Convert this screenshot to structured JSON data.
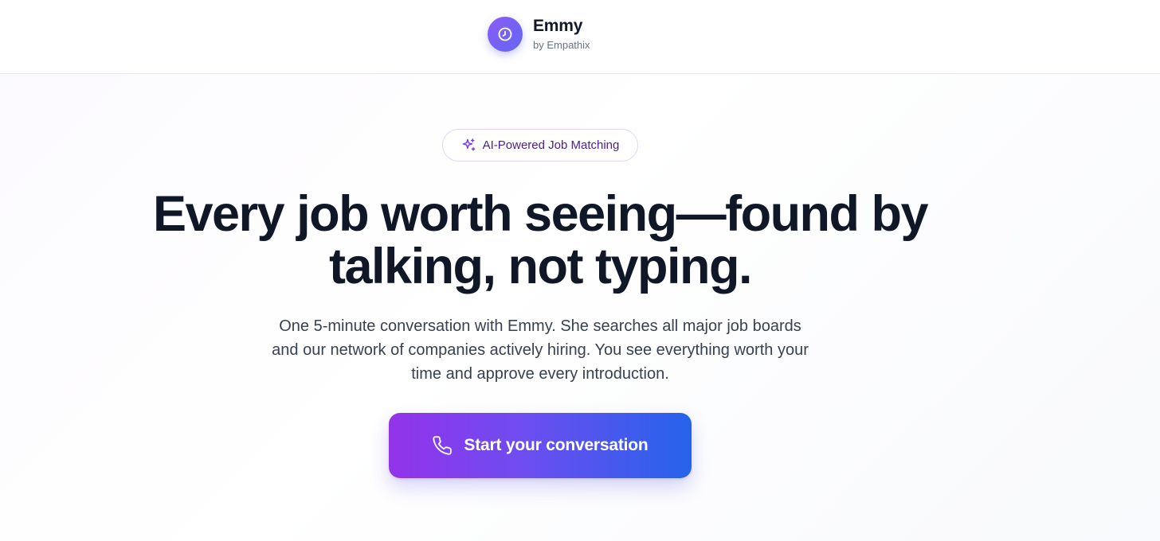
{
  "brand": {
    "name": "Emmy",
    "subtitle": "by Empathix",
    "logo_icon": "clock-face-icon",
    "accent_start": "#8b5cf6",
    "accent_end": "#6366f1"
  },
  "badge": {
    "icon": "sparkles-icon",
    "label": "AI-Powered Job Matching"
  },
  "hero": {
    "headline_lines": [
      "Every job worth seeing—found by",
      "talking, not typing."
    ],
    "subtext_lines": [
      "One 5-minute conversation with Emmy. She searches all major job boards",
      "and our network of companies actively hiring. You see everything worth your",
      "time and approve every introduction."
    ]
  },
  "cta": {
    "icon": "phone-icon",
    "label": "Start your conversation",
    "gradient_start": "#9333ea",
    "gradient_end": "#2563eb"
  }
}
